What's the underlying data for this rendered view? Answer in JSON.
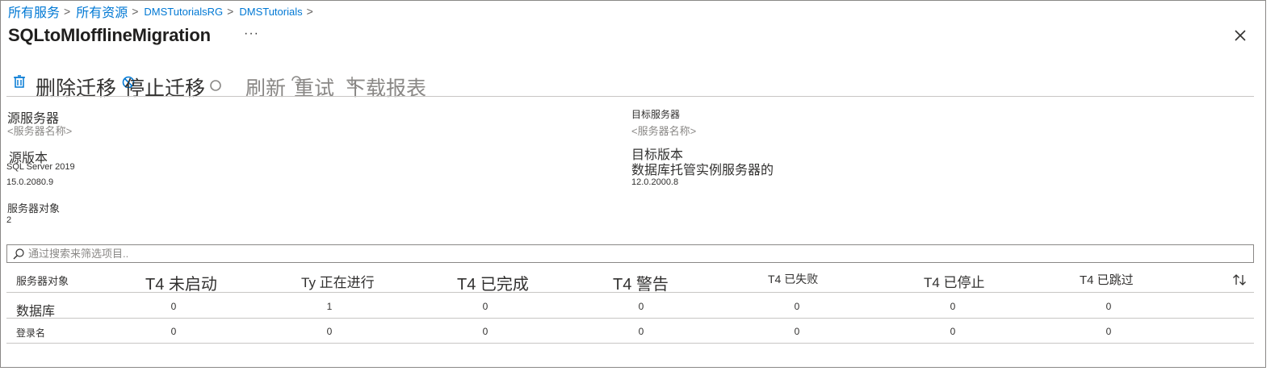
{
  "breadcrumb": {
    "items": [
      "所有服务",
      "所有资源",
      "DMSTutorialsRG",
      "DMSTutorials"
    ],
    "separator": ">"
  },
  "header": {
    "title": "SQLtoMIofflineMigration",
    "more": "···",
    "close_icon": "close-icon"
  },
  "toolbar": {
    "delete": "删除迁移",
    "stop": "停止迁移",
    "refresh": "刷新",
    "retry": "重试",
    "download": "下载报表"
  },
  "source": {
    "server_label": "源服务器",
    "server_value": "<服务器名称>",
    "version_label": "源版本",
    "version_name": "SQL Server 2019",
    "version_number": "15.0.2080.9"
  },
  "target": {
    "server_label": "目标服务器",
    "server_value": "<服务器名称>",
    "version_label": "目标版本",
    "version_name": "数据库托管实例服务器的",
    "version_number": "12.0.2000.8"
  },
  "server_objects": {
    "label": "服务器对象",
    "value": "2"
  },
  "search": {
    "placeholder": "通过搜索来筛选项目.."
  },
  "table": {
    "columns": [
      "服务器对象",
      "T4 未启动",
      "Ty 正在进行",
      "T4 已完成",
      "T4 警告",
      "T4 已失败",
      "T4 已停止",
      "T4 已跳过"
    ],
    "rows": [
      {
        "name": "数据库",
        "values": [
          "0",
          "1",
          "0",
          "0",
          "0",
          "0",
          "0"
        ]
      },
      {
        "name": "登录名",
        "values": [
          "0",
          "0",
          "0",
          "0",
          "0",
          "0",
          "0"
        ]
      }
    ]
  },
  "colors": {
    "accent": "#0078d4",
    "text": "#323130",
    "muted": "#8a8886",
    "border": "#c8c6c4"
  }
}
